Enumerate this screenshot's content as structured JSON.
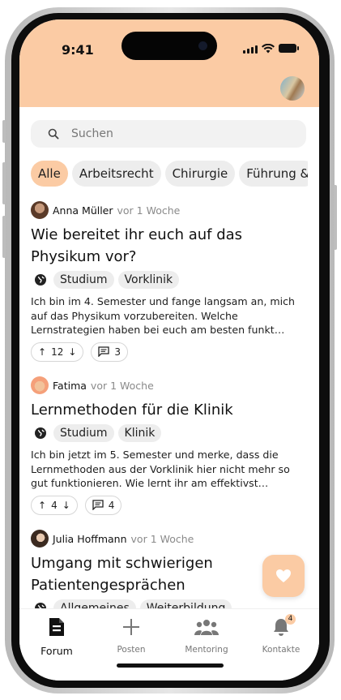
{
  "status_bar": {
    "time": "9:41"
  },
  "search": {
    "placeholder": "Suchen"
  },
  "categories": [
    {
      "label": "Alle",
      "active": true
    },
    {
      "label": "Arbeitsrecht"
    },
    {
      "label": "Chirurgie"
    },
    {
      "label": "Führung &"
    }
  ],
  "posts": [
    {
      "author": "Anna Müller",
      "time": "vor 1 Woche",
      "title": "Wie bereitet ihr euch auf das Physikum vor?",
      "tags": [
        "Studium",
        "Vorklinik"
      ],
      "body": "Ich bin im 4. Semester und fange langsam an, mich auf das Physikum vorzubereiten. Welche Lernstrategien haben bei euch am besten funkt…",
      "votes": "12",
      "comments": "3"
    },
    {
      "author": "Fatima",
      "time": "vor 1 Woche",
      "title": "Lernmethoden für die Klinik",
      "tags": [
        "Studium",
        "Klinik"
      ],
      "body": "Ich bin jetzt im 5. Semester und merke, dass die Lernmethoden aus der Vorklinik hier nicht mehr so gut funktionieren. Wie lernt ihr am effektivst…",
      "votes": "4",
      "comments": "4"
    },
    {
      "author": "Julia Hoffmann",
      "time": "vor 1 Woche",
      "title": "Umgang mit schwierigen Patientengesprächen",
      "tags": [
        "Allgemeines",
        "Weiterbildung"
      ]
    }
  ],
  "nav": {
    "items": [
      {
        "label": "Forum",
        "icon": "document-icon",
        "active": true
      },
      {
        "label": "Posten",
        "icon": "plus-icon"
      },
      {
        "label": "Mentoring",
        "icon": "group-icon"
      },
      {
        "label": "Kontakte",
        "icon": "bell-icon",
        "badge": "4"
      }
    ]
  },
  "colors": {
    "accent": "#fbcba4",
    "chip": "#ededed"
  }
}
